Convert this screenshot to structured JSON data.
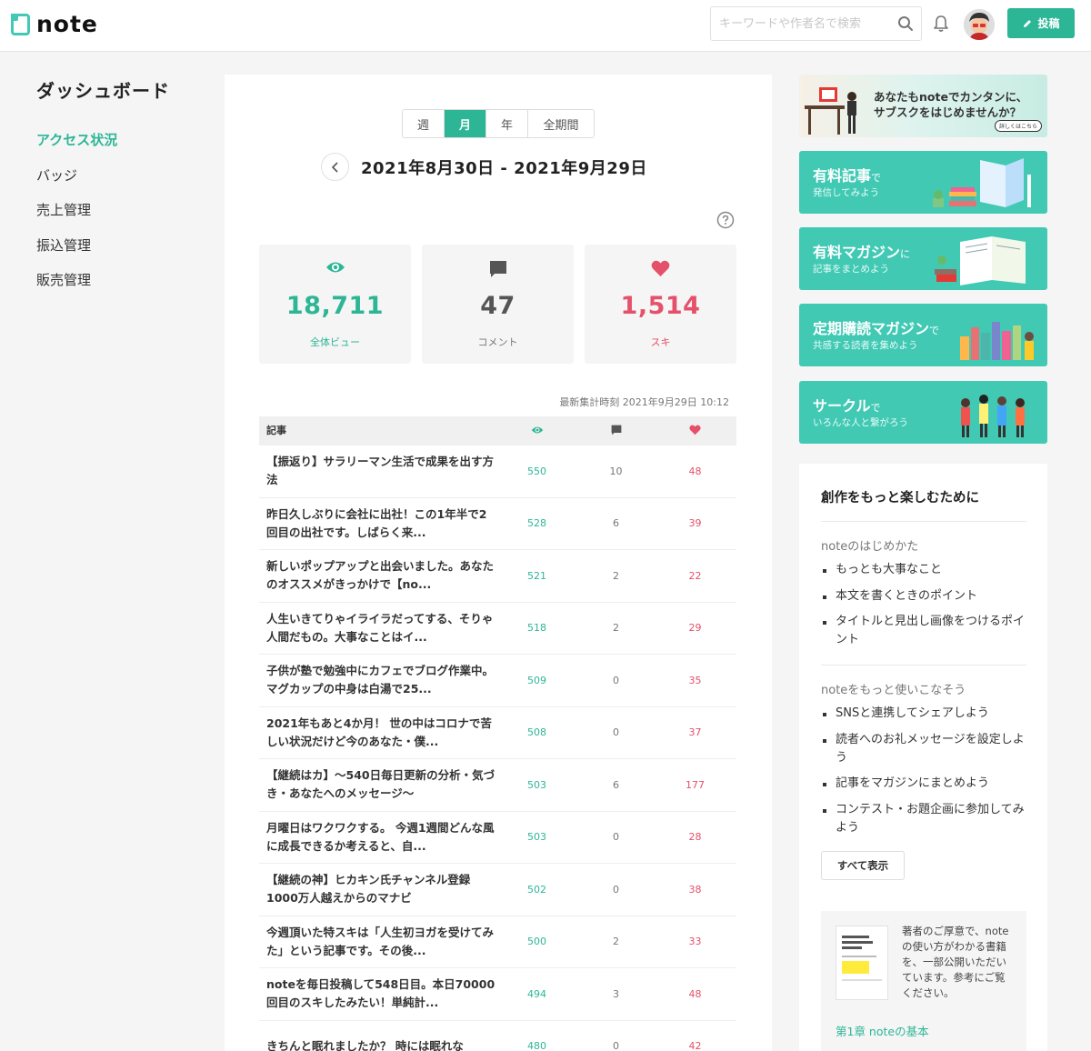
{
  "header": {
    "logo_text": "note",
    "search_placeholder": "キーワードや作者名で検索",
    "post_label": "投稿"
  },
  "sidebar": {
    "title": "ダッシュボード",
    "items": [
      {
        "label": "アクセス状況",
        "active": true
      },
      {
        "label": "バッジ"
      },
      {
        "label": "売上管理"
      },
      {
        "label": "振込管理"
      },
      {
        "label": "販売管理"
      }
    ]
  },
  "main": {
    "tabs": [
      {
        "label": "週"
      },
      {
        "label": "月",
        "active": true
      },
      {
        "label": "年"
      },
      {
        "label": "全期間"
      }
    ],
    "date_range": "2021年8月30日 - 2021年9月29日",
    "stats": [
      {
        "icon": "eye-icon",
        "value": "18,711",
        "label": "全体ビュー",
        "color": "#2cb696"
      },
      {
        "icon": "comment-icon",
        "value": "47",
        "label": "コメント",
        "color": "#555555"
      },
      {
        "icon": "heart-icon",
        "value": "1,514",
        "label": "スキ",
        "color": "#e5516a"
      }
    ],
    "updated": "最新集計時刻 2021年9月29日 10:12",
    "table": {
      "header_title": "記事",
      "rows": [
        {
          "title": "【振返り】サラリーマン生活で成果を出す方法",
          "views": "550",
          "comments": "10",
          "likes": "48"
        },
        {
          "title": "昨日久しぶりに会社に出社！この1年半で2回目の出社です。しばらく来...",
          "views": "528",
          "comments": "6",
          "likes": "39"
        },
        {
          "title": "新しいポップアップと出会いました。あなたのオススメがきっかけで【no...",
          "views": "521",
          "comments": "2",
          "likes": "22"
        },
        {
          "title": "人生いきてりゃイライラだってする、そりゃ人間だもの。大事なことはイ...",
          "views": "518",
          "comments": "2",
          "likes": "29"
        },
        {
          "title": "子供が塾で勉強中にカフェでブログ作業中。マグカップの中身は白湯で25...",
          "views": "509",
          "comments": "0",
          "likes": "35"
        },
        {
          "title": "2021年もあと4か月！ 世の中はコロナで苦しい状況だけど今のあなた・僕...",
          "views": "508",
          "comments": "0",
          "likes": "37"
        },
        {
          "title": "【継続はカ】～540日毎日更新の分析・気づき・あなたへのメッセージ～",
          "views": "503",
          "comments": "6",
          "likes": "177"
        },
        {
          "title": "月曜日はワクワクする。 今週1週間どんな風に成長できるか考えると、自...",
          "views": "503",
          "comments": "0",
          "likes": "28"
        },
        {
          "title": "【継続の神】ヒカキン氏チャンネル登録1000万人越えからのマナビ",
          "views": "502",
          "comments": "0",
          "likes": "38"
        },
        {
          "title": "今週頂いた特スキは「人生初ヨガを受けてみた」という記事です。その後...",
          "views": "500",
          "comments": "2",
          "likes": "33"
        },
        {
          "title": "noteを毎日投稿して548日目。本日70000回目のスキしたみたい！単純計...",
          "views": "494",
          "comments": "3",
          "likes": "48"
        },
        {
          "title": "きちんと眠れましたか？ 時には眠れな",
          "views": "480",
          "comments": "0",
          "likes": "42"
        }
      ]
    }
  },
  "right": {
    "promo_top": {
      "line1": "あなたもnoteでカンタンに、",
      "line2": "サブスクをはじめませんか？",
      "button": "詳しくはこちら"
    },
    "banners": [
      {
        "title": "有料記事",
        "suffix": "で",
        "sub": "発信してみよう"
      },
      {
        "title": "有料マガジン",
        "suffix": "に",
        "sub": "記事をまとめよう"
      },
      {
        "title": "定期購読マガジン",
        "suffix": "で",
        "sub": "共感する読者を集めよう"
      },
      {
        "title": "サークル",
        "suffix": "で",
        "sub": "いろんな人と繋がろう"
      }
    ],
    "guide": {
      "title": "創作をもっと楽しむために",
      "section1": "noteのはじめかた",
      "list1": [
        "もっとも大事なこと",
        "本文を書くときのポイント",
        "タイトルと見出し画像をつけるポイント"
      ],
      "section2": "noteをもっと使いこなそう",
      "list2": [
        "SNSと連携してシェアしよう",
        "読者へのお礼メッセージを設定しよう",
        "記事をマガジンにまとめよう",
        "コンテスト・お題企画に参加してみよう"
      ],
      "show_all": "すべて表示",
      "book_text": "著者のご厚意で、noteの使い方がわかる書籍を、一部公開いただいています。参考にご覧ください。",
      "book_link": "第1章 noteの基本"
    }
  },
  "colors": {
    "accent": "#2cb696",
    "like": "#e5516a"
  }
}
